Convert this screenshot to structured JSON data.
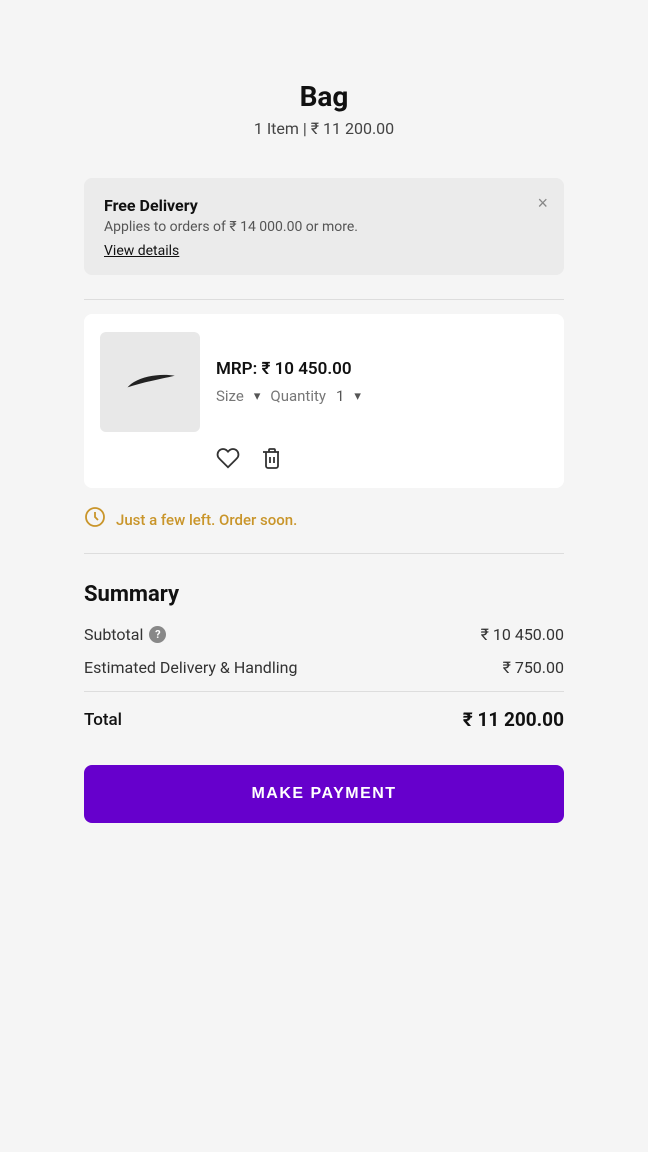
{
  "header": {
    "title": "Bag",
    "subtitle": "1 Item | ₹ 11 200.00"
  },
  "delivery_banner": {
    "title": "Free Delivery",
    "description": "Applies to orders of ₹ 14 000.00 or more.",
    "link_text": "View details",
    "close_icon": "×"
  },
  "product": {
    "mrp": "MRP: ₹ 10 450.00",
    "size_label": "Size",
    "size_arrow": "▾",
    "quantity_label": "Quantity",
    "quantity_value": "1",
    "quantity_arrow": "▾",
    "wishlist_icon": "♡",
    "delete_icon": "🗑"
  },
  "urgency": {
    "text": "Just a few left. Order soon."
  },
  "summary": {
    "title": "Summary",
    "subtotal_label": "Subtotal",
    "subtotal_value": "₹ 10 450.00",
    "delivery_label": "Estimated Delivery & Handling",
    "delivery_value": "₹ 750.00",
    "total_label": "Total",
    "total_value": "₹ 11 200.00"
  },
  "cta": {
    "label": "MAKE PAYMENT"
  },
  "colors": {
    "accent_purple": "#6600cc",
    "urgency_gold": "#c9952a"
  }
}
